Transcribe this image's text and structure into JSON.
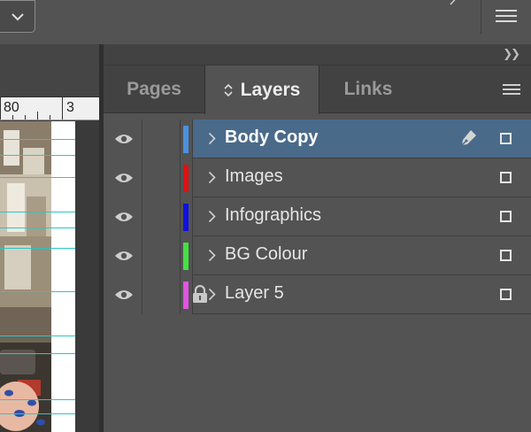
{
  "ruler": {
    "labels": [
      "80",
      "3"
    ]
  },
  "panel": {
    "tabs": [
      {
        "label": "Pages",
        "active": false
      },
      {
        "label": "Layers",
        "active": true
      },
      {
        "label": "Links",
        "active": false
      }
    ]
  },
  "layers": [
    {
      "name": "Body Copy",
      "color": "#4a90e2",
      "visible": true,
      "locked": false,
      "selected": true,
      "editing": true
    },
    {
      "name": "Images",
      "color": "#e01010",
      "visible": true,
      "locked": false,
      "selected": false,
      "editing": false
    },
    {
      "name": "Infographics",
      "color": "#1010e0",
      "visible": true,
      "locked": false,
      "selected": false,
      "editing": false
    },
    {
      "name": "BG Colour",
      "color": "#44e044",
      "visible": true,
      "locked": false,
      "selected": false,
      "editing": false
    },
    {
      "name": "Layer 5",
      "color": "#e055e0",
      "visible": true,
      "locked": true,
      "selected": false,
      "editing": false
    }
  ],
  "icons": {
    "top_dropdown": "chevron-down-icon",
    "top_menu": "hamburger-menu-icon",
    "collapse": "double-chevron-right-icon",
    "panel_menu": "panel-menu-icon",
    "visibility": "eye-icon",
    "lock": "lock-icon",
    "expand": "chevron-right-icon",
    "edit": "pen-icon",
    "target": "square-target-icon",
    "sort": "up-down-arrows-icon"
  }
}
